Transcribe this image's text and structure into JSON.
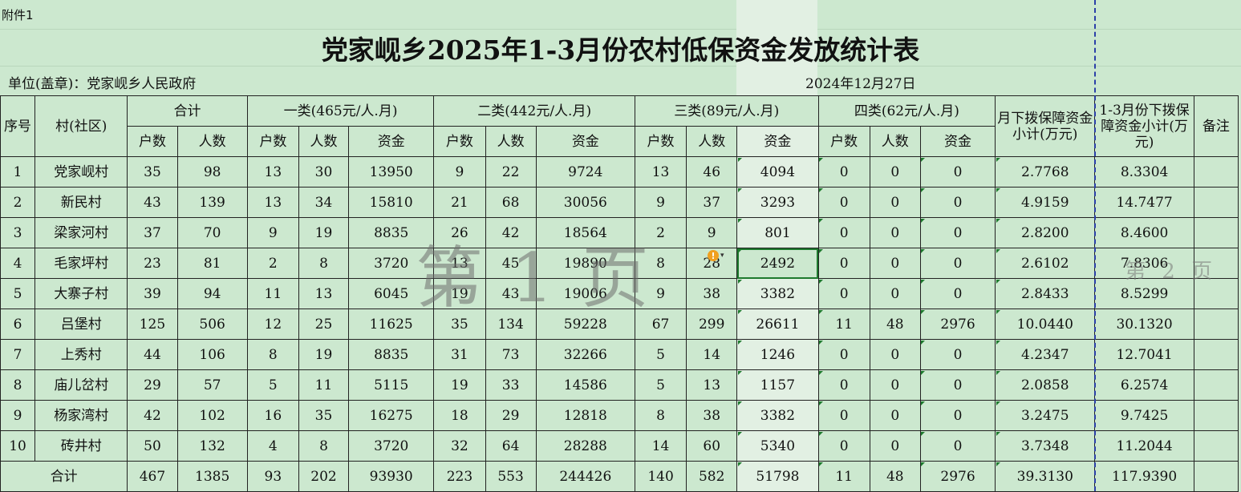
{
  "annex_label": "附件1",
  "title": "党家岘乡2025年1-3月份农村低保资金发放统计表",
  "unit_label": "单位(盖章)：党家岘乡人民政府",
  "date": "2024年12月27日",
  "watermark_page1": "第 1 页",
  "watermark_page2": "第 2 页",
  "header": {
    "seq": "序号",
    "village": "村(社区)",
    "total_group": "合计",
    "class1": "一类(465元/人.月)",
    "class2": "二类(442元/人.月)",
    "class3": "三类(89元/人.月)",
    "class4": "四类(62元/人.月)",
    "monthly_subtotal": "月下拨保障资金小计(万元)",
    "quarter_subtotal": "1-3月份下拨保障资金小计(万元)",
    "remark": "备注",
    "households": "户数",
    "persons": "人数",
    "funds": "资金"
  },
  "rows": [
    {
      "seq": "1",
      "village": "党家岘村",
      "t_h": "35",
      "t_p": "98",
      "c1_h": "13",
      "c1_p": "30",
      "c1_f": "13950",
      "c2_h": "9",
      "c2_p": "22",
      "c2_f": "9724",
      "c3_h": "13",
      "c3_p": "46",
      "c3_f": "4094",
      "c4_h": "0",
      "c4_p": "0",
      "c4_f": "0",
      "monthly": "2.7768",
      "quarter": "8.3304",
      "remark": ""
    },
    {
      "seq": "2",
      "village": "新民村",
      "t_h": "43",
      "t_p": "139",
      "c1_h": "13",
      "c1_p": "34",
      "c1_f": "15810",
      "c2_h": "21",
      "c2_p": "68",
      "c2_f": "30056",
      "c3_h": "9",
      "c3_p": "37",
      "c3_f": "3293",
      "c4_h": "0",
      "c4_p": "0",
      "c4_f": "0",
      "monthly": "4.9159",
      "quarter": "14.7477",
      "remark": ""
    },
    {
      "seq": "3",
      "village": "梁家河村",
      "t_h": "37",
      "t_p": "70",
      "c1_h": "9",
      "c1_p": "19",
      "c1_f": "8835",
      "c2_h": "26",
      "c2_p": "42",
      "c2_f": "18564",
      "c3_h": "2",
      "c3_p": "9",
      "c3_f": "801",
      "c4_h": "0",
      "c4_p": "0",
      "c4_f": "0",
      "monthly": "2.8200",
      "quarter": "8.4600",
      "remark": ""
    },
    {
      "seq": "4",
      "village": "毛家坪村",
      "t_h": "23",
      "t_p": "81",
      "c1_h": "2",
      "c1_p": "8",
      "c1_f": "3720",
      "c2_h": "13",
      "c2_p": "45",
      "c2_f": "19890",
      "c3_h": "8",
      "c3_p": "28",
      "c3_f": "2492",
      "c4_h": "0",
      "c4_p": "0",
      "c4_f": "0",
      "monthly": "2.6102",
      "quarter": "7.8306",
      "remark": ""
    },
    {
      "seq": "5",
      "village": "大寨子村",
      "t_h": "39",
      "t_p": "94",
      "c1_h": "11",
      "c1_p": "13",
      "c1_f": "6045",
      "c2_h": "19",
      "c2_p": "43",
      "c2_f": "19006",
      "c3_h": "9",
      "c3_p": "38",
      "c3_f": "3382",
      "c4_h": "0",
      "c4_p": "0",
      "c4_f": "0",
      "monthly": "2.8433",
      "quarter": "8.5299",
      "remark": ""
    },
    {
      "seq": "6",
      "village": "吕堡村",
      "t_h": "125",
      "t_p": "506",
      "c1_h": "12",
      "c1_p": "25",
      "c1_f": "11625",
      "c2_h": "35",
      "c2_p": "134",
      "c2_f": "59228",
      "c3_h": "67",
      "c3_p": "299",
      "c3_f": "26611",
      "c4_h": "11",
      "c4_p": "48",
      "c4_f": "2976",
      "monthly": "10.0440",
      "quarter": "30.1320",
      "remark": ""
    },
    {
      "seq": "7",
      "village": "上秀村",
      "t_h": "44",
      "t_p": "106",
      "c1_h": "8",
      "c1_p": "19",
      "c1_f": "8835",
      "c2_h": "31",
      "c2_p": "73",
      "c2_f": "32266",
      "c3_h": "5",
      "c3_p": "14",
      "c3_f": "1246",
      "c4_h": "0",
      "c4_p": "0",
      "c4_f": "0",
      "monthly": "4.2347",
      "quarter": "12.7041",
      "remark": ""
    },
    {
      "seq": "8",
      "village": "庙儿岔村",
      "t_h": "29",
      "t_p": "57",
      "c1_h": "5",
      "c1_p": "11",
      "c1_f": "5115",
      "c2_h": "19",
      "c2_p": "33",
      "c2_f": "14586",
      "c3_h": "5",
      "c3_p": "13",
      "c3_f": "1157",
      "c4_h": "0",
      "c4_p": "0",
      "c4_f": "0",
      "monthly": "2.0858",
      "quarter": "6.2574",
      "remark": ""
    },
    {
      "seq": "9",
      "village": "杨家湾村",
      "t_h": "42",
      "t_p": "102",
      "c1_h": "16",
      "c1_p": "35",
      "c1_f": "16275",
      "c2_h": "18",
      "c2_p": "29",
      "c2_f": "12818",
      "c3_h": "8",
      "c3_p": "38",
      "c3_f": "3382",
      "c4_h": "0",
      "c4_p": "0",
      "c4_f": "0",
      "monthly": "3.2475",
      "quarter": "9.7425",
      "remark": ""
    },
    {
      "seq": "10",
      "village": "砖井村",
      "t_h": "50",
      "t_p": "132",
      "c1_h": "4",
      "c1_p": "8",
      "c1_f": "3720",
      "c2_h": "32",
      "c2_p": "64",
      "c2_f": "28288",
      "c3_h": "14",
      "c3_p": "60",
      "c3_f": "5340",
      "c4_h": "0",
      "c4_p": "0",
      "c4_f": "0",
      "monthly": "3.7348",
      "quarter": "11.2044",
      "remark": ""
    }
  ],
  "totals": {
    "label": "合计",
    "t_h": "467",
    "t_p": "1385",
    "c1_h": "93",
    "c1_p": "202",
    "c1_f": "93930",
    "c2_h": "223",
    "c2_p": "553",
    "c2_f": "244426",
    "c3_h": "140",
    "c3_p": "582",
    "c3_f": "51798",
    "c4_h": "11",
    "c4_p": "48",
    "c4_f": "2976",
    "monthly": "39.3130",
    "quarter": "117.9390",
    "remark": ""
  },
  "colors": {
    "sheet_bg": "#cce8cf",
    "grid": "#222222",
    "selection": "#1e7a2e",
    "page_break": "#2b3fa8",
    "warning": "#f0a020"
  }
}
